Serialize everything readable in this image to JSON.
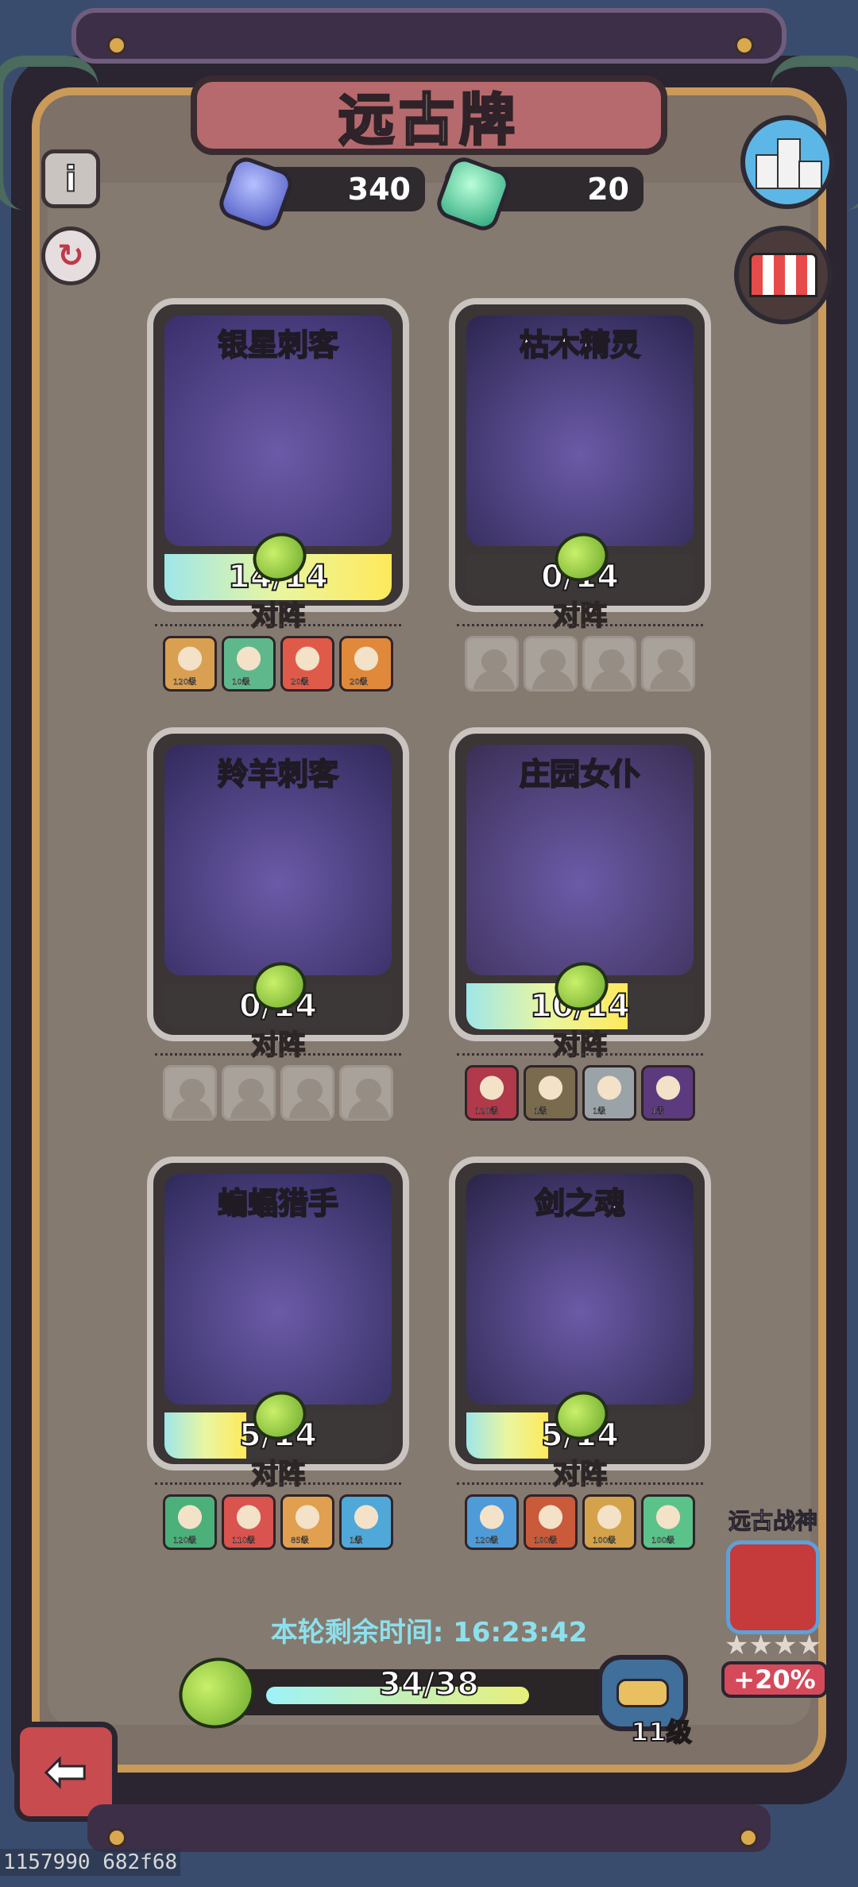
{
  "title": "远古牌",
  "currencies": [
    {
      "name": "purple-gem",
      "value": "340",
      "color": "#7a86e0"
    },
    {
      "name": "green-gem",
      "value": "20",
      "color": "#4fd6a6"
    }
  ],
  "cards": [
    {
      "name": "银星刺客",
      "progress": "14/14",
      "fill": 1.0,
      "lineup_label": "对阵",
      "lineup": [
        {
          "lv": "120级",
          "color": "#d8a050"
        },
        {
          "lv": "10级",
          "color": "#5fb88c"
        },
        {
          "lv": "20级",
          "color": "#e05a4a"
        },
        {
          "lv": "20级",
          "color": "#e0893a"
        }
      ]
    },
    {
      "name": "枯木精灵",
      "progress": "0/14",
      "fill": 0.0,
      "lineup_label": "对阵",
      "lineup": []
    },
    {
      "name": "羚羊刺客",
      "progress": "0/14",
      "fill": 0.0,
      "lineup_label": "对阵",
      "lineup": []
    },
    {
      "name": "庄园女仆",
      "progress": "10/14",
      "fill": 0.71,
      "lineup_label": "对阵",
      "lineup": [
        {
          "lv": "120级",
          "color": "#b0394a"
        },
        {
          "lv": "1级",
          "color": "#7a6a4e"
        },
        {
          "lv": "1级",
          "color": "#9aa3a8"
        },
        {
          "lv": "1级",
          "color": "#5b3b7e"
        }
      ]
    },
    {
      "name": "蝙蝠猎手",
      "progress": "5/14",
      "fill": 0.36,
      "lineup_label": "对阵",
      "lineup": [
        {
          "lv": "120级",
          "color": "#4bb07a"
        },
        {
          "lv": "110级",
          "color": "#d9534f"
        },
        {
          "lv": "85级",
          "color": "#e0a050"
        },
        {
          "lv": "1级",
          "color": "#4fa8d8"
        }
      ]
    },
    {
      "name": "剑之魂",
      "progress": "5/14",
      "fill": 0.36,
      "lineup_label": "对阵",
      "lineup": [
        {
          "lv": "120级",
          "color": "#4f9ad8"
        },
        {
          "lv": "100级",
          "color": "#c95a3a"
        },
        {
          "lv": "100级",
          "color": "#d4a24a"
        },
        {
          "lv": "100级",
          "color": "#5bc28a"
        }
      ]
    }
  ],
  "timer": "本轮剩余时间: 16:23:42",
  "xp": {
    "text": "34/38",
    "fill": 0.895,
    "level": "11级"
  },
  "bonus": {
    "title": "远古战神",
    "stars": "★★★★",
    "value": "+20%"
  },
  "footer_id": "1157990 682f68"
}
